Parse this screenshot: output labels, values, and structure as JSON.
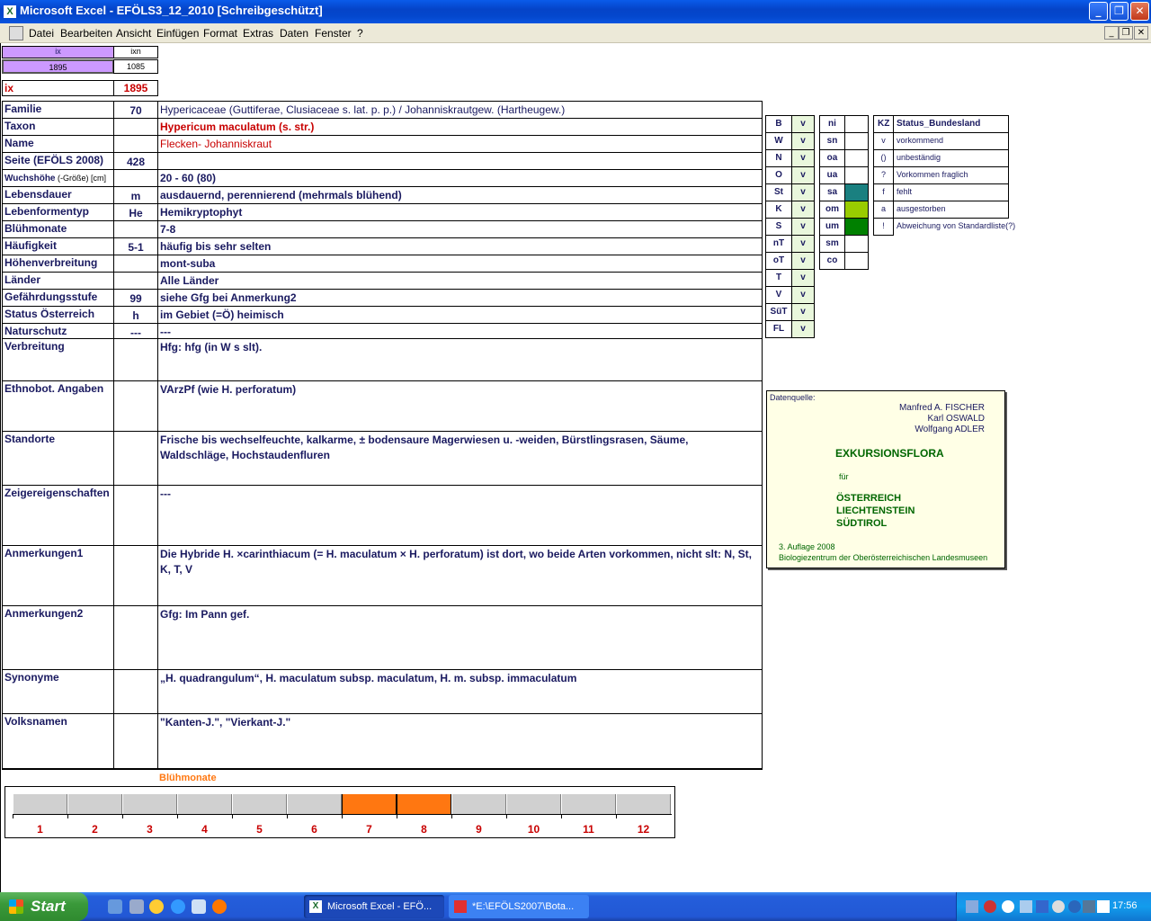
{
  "window": {
    "title": "Microsoft Excel - EFÖLS3_12_2010  [Schreibgeschützt]",
    "min": "_",
    "max": "❐",
    "close": "✕"
  },
  "menu": [
    "Datei",
    "Bearbeiten",
    "Ansicht",
    "Einfügen",
    "Format",
    "Extras",
    "Daten",
    "Fenster",
    "?"
  ],
  "top": {
    "ix_hdr": "ix",
    "ixn_hdr": "ixn",
    "ix_val": "1895",
    "ixn_val": "1085",
    "ix_label": "ix",
    "ix_big": "1895"
  },
  "rows": [
    {
      "label": "Familie",
      "code": "70",
      "value": "Hypericaceae (Guttiferae, Clusiaceae s. lat. p. p.)  /  Johanniskrautgew. (Hartheugew.)"
    },
    {
      "label": "Taxon",
      "code": "",
      "value": "Hypericum maculatum (s. str.)"
    },
    {
      "label": "Name",
      "code": "",
      "value": "Flecken- Johanniskraut"
    },
    {
      "label": "Seite (EFÖLS 2008)",
      "code": "428",
      "value": ""
    },
    {
      "label": "Wuchshöhe",
      "label_small": " (-Größe) [cm]",
      "code": "",
      "value": " 20 - 60 (80)"
    },
    {
      "label": "Lebensdauer",
      "code": "m",
      "value": "ausdauernd, perennierend (mehrmals blühend)"
    },
    {
      "label": "Lebenformentyp",
      "code": "He",
      "value": "Hemikryptophyt"
    },
    {
      "label": "Blühmonate",
      "code": "",
      "value": " 7-8"
    },
    {
      "label": "Häufigkeit",
      "code": "5-1",
      "value": "häufig bis sehr selten"
    },
    {
      "label": "Höhenverbreitung",
      "code": "",
      "value": "mont-suba"
    },
    {
      "label": "Länder",
      "code": "",
      "value": "Alle Länder"
    },
    {
      "label": "Gefährdungsstufe",
      "code": "99",
      "value": "siehe Gfg bei Anmerkung2"
    },
    {
      "label": "Status Österreich",
      "code": "h",
      "value": "im Gebiet (=Ö) heimisch"
    },
    {
      "label": "Naturschutz",
      "code": "---",
      "value": " ---"
    },
    {
      "label": "Verbreitung",
      "code": "",
      "value": " Hfg: hfg (in W s slt)."
    },
    {
      "label": "Ethnobot. Angaben",
      "code": "",
      "value": "VArzPf (wie H. perforatum)"
    },
    {
      "label": "Standorte",
      "code": "",
      "value": "Frische bis wechselfeuchte, kalkarme, ± bodensaure Magerwiesen u. -weiden, Bürstlingsrasen, Säume, Waldschläge, Hochstaudenfluren"
    },
    {
      "label": "Zeigereigenschaften",
      "code": "",
      "value": "---"
    },
    {
      "label": "Anmerkungen1",
      "code": "",
      "value": "Die Hybride H. ×carinthiacum (= H. maculatum × H. perforatum) ist dort, wo beide Arten vorkommen, nicht slt: N, St, K, T, V"
    },
    {
      "label": "Anmerkungen2",
      "code": "",
      "value": "Gfg: Im Pann gef."
    },
    {
      "label": "Synonyme",
      "code": "",
      "value": "„H. quadrangulum“, H. maculatum subsp. maculatum, H. m. subsp. immaculatum"
    },
    {
      "label": "Volksnamen",
      "code": "",
      "value": "\"Kanten-J.\", \"Vierkant-J.\""
    }
  ],
  "bundeslaender": [
    {
      "k": "B",
      "v": "v"
    },
    {
      "k": "W",
      "v": "v"
    },
    {
      "k": "N",
      "v": "v"
    },
    {
      "k": "O",
      "v": "v"
    },
    {
      "k": "St",
      "v": "v"
    },
    {
      "k": "K",
      "v": "v"
    },
    {
      "k": "S",
      "v": "v"
    },
    {
      "k": "nT",
      "v": "v"
    },
    {
      "k": "oT",
      "v": "v"
    },
    {
      "k": "T",
      "v": "v"
    },
    {
      "k": "V",
      "v": "v"
    },
    {
      "k": "SüT",
      "v": "v"
    },
    {
      "k": "FL",
      "v": "v"
    }
  ],
  "hoehen": [
    {
      "k": "ni",
      "color": ""
    },
    {
      "k": "sn",
      "color": ""
    },
    {
      "k": "oa",
      "color": ""
    },
    {
      "k": "ua",
      "color": ""
    },
    {
      "k": "sa",
      "color": "#1a8080"
    },
    {
      "k": "om",
      "color": "#99cc00"
    },
    {
      "k": "um",
      "color": "#008000"
    },
    {
      "k": "sm",
      "color": ""
    },
    {
      "k": "co",
      "color": ""
    }
  ],
  "status_legend": {
    "kz_header": "KZ",
    "text_header": "Status_Bundesland",
    "items": [
      {
        "kz": "v",
        "text": "vorkommend"
      },
      {
        "kz": "()",
        "text": "unbeständig"
      },
      {
        "kz": "?",
        "text": "Vorkommen fraglich"
      },
      {
        "kz": "f",
        "text": "fehlt"
      },
      {
        "kz": "a",
        "text": "ausgestorben"
      },
      {
        "kz": "!",
        "text": "Abweichung von Standardliste(?)"
      }
    ]
  },
  "datenquelle": {
    "label": "Datenquelle:",
    "authors": [
      "Manfred A. FISCHER",
      "Karl OSWALD",
      "Wolfgang ADLER"
    ],
    "title": "EXKURSIONSFLORA",
    "fuer": "für",
    "regions": [
      "ÖSTERREICH",
      "LIECHTENSTEIN",
      "SÜDTIROL"
    ],
    "edition": "3. Auflage 2008",
    "publisher": "Biologiezentrum der Oberösterreichischen Landesmuseen"
  },
  "bluehmonate": {
    "title": "Blühmonate",
    "months": [
      "1",
      "2",
      "3",
      "4",
      "5",
      "6",
      "7",
      "8",
      "9",
      "10",
      "11",
      "12"
    ],
    "active": [
      false,
      false,
      false,
      false,
      false,
      false,
      true,
      true,
      false,
      false,
      false,
      false
    ],
    "active_color": "#ff7711"
  },
  "taskbar": {
    "start": "Start",
    "items": [
      "Microsoft Excel - EFÖ...",
      "*E:\\EFÖLS2007\\Bota..."
    ],
    "clock": "17:56"
  }
}
